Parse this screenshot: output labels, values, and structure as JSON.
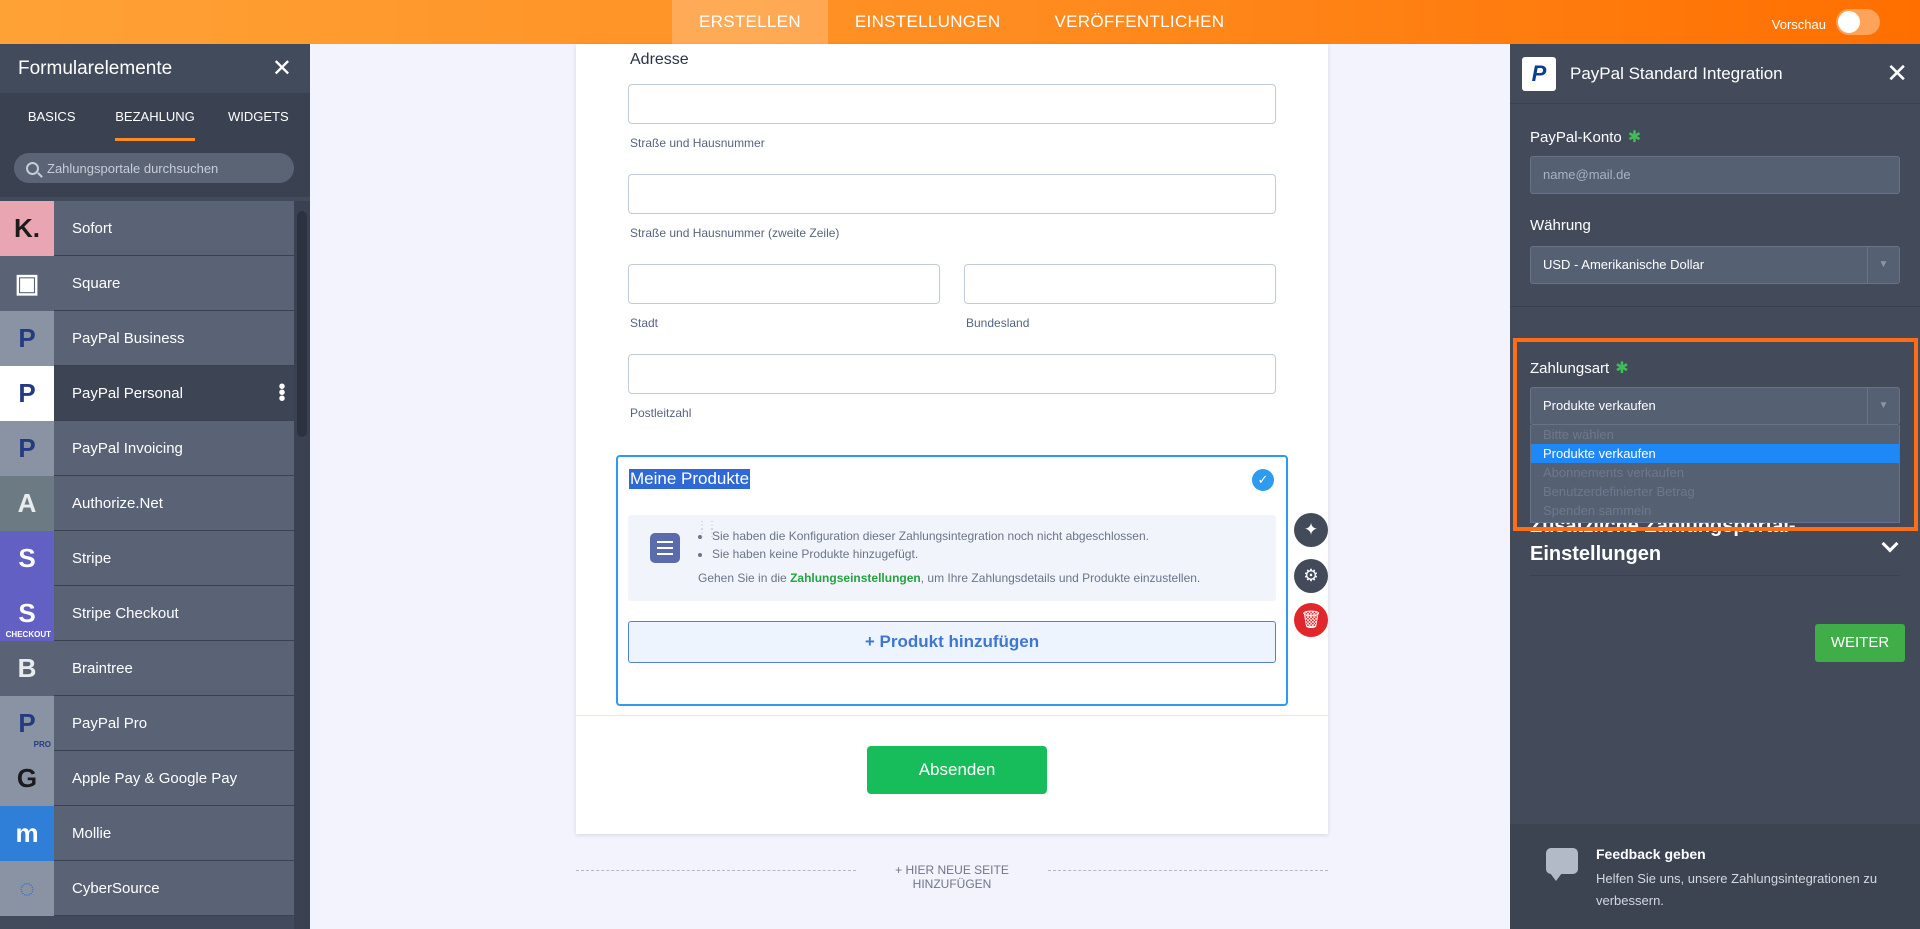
{
  "topbar": {
    "tabs": [
      "ERSTELLEN",
      "EINSTELLUNGEN",
      "VERÖFFENTLICHEN"
    ],
    "active_tab": "ERSTELLEN",
    "preview_label": "Vorschau"
  },
  "left_panel": {
    "title": "Formularelemente",
    "tabs": [
      "BASICS",
      "BEZAHLUNG",
      "WIDGETS"
    ],
    "active_tab": "BEZAHLUNG",
    "search_placeholder": "Zahlungsportale durchsuchen",
    "items": [
      {
        "label": "Sofort",
        "icon": "sofort-icon",
        "glyph": "K.",
        "bg": "#eaa5b2",
        "fg": "#1b1b1b"
      },
      {
        "label": "Square",
        "icon": "square-icon",
        "glyph": "▣",
        "bg": "#5a6375",
        "fg": "#ffffff"
      },
      {
        "label": "PayPal Business",
        "icon": "paypal-business-icon",
        "glyph": "P",
        "bg": "#8a93a4",
        "fg": "#253b80"
      },
      {
        "label": "PayPal Personal",
        "icon": "paypal-personal-icon",
        "glyph": "P",
        "bg": "#ffffff",
        "fg": "#253b80"
      },
      {
        "label": "PayPal Invoicing",
        "icon": "paypal-invoicing-icon",
        "glyph": "P",
        "bg": "#8a93a4",
        "fg": "#253b80"
      },
      {
        "label": "Authorize.Net",
        "icon": "authorize-net-icon",
        "glyph": "A",
        "bg": "#6b7a83",
        "fg": "#e8ecef"
      },
      {
        "label": "Stripe",
        "icon": "stripe-icon",
        "glyph": "S",
        "bg": "#6360c4",
        "fg": "#ffffff"
      },
      {
        "label": "Stripe Checkout",
        "icon": "stripe-checkout-icon",
        "glyph": "S",
        "bg": "#6360c4",
        "fg": "#ffffff",
        "caption": "CHECKOUT"
      },
      {
        "label": "Braintree",
        "icon": "braintree-icon",
        "glyph": "B",
        "bg": "#5a6375",
        "fg": "#e8ecef"
      },
      {
        "label": "PayPal Pro",
        "icon": "paypal-pro-icon",
        "glyph": "P",
        "bg": "#8a93a4",
        "fg": "#253b80",
        "caption": "PRO"
      },
      {
        "label": "Apple Pay & Google Pay",
        "icon": "apple-google-pay-icon",
        "glyph": "G",
        "bg": "#8a93a4",
        "fg": "#1b1b1b"
      },
      {
        "label": "Mollie",
        "icon": "mollie-icon",
        "glyph": "m",
        "bg": "#2f7fd8",
        "fg": "#ffffff"
      },
      {
        "label": "CyberSource",
        "icon": "cybersource-icon",
        "glyph": "◌",
        "bg": "#8a93a4",
        "fg": "#2d6fd1"
      }
    ],
    "selected_item": "PayPal Personal"
  },
  "form": {
    "address_label": "Adresse",
    "street_label": "Straße und Hausnummer",
    "street2_label": "Straße und Hausnummer (zweite Zeile)",
    "city_label": "Stadt",
    "state_label": "Bundesland",
    "zip_label": "Postleitzahl",
    "products_title": "Meine Produkte",
    "notice_items": [
      "Sie haben die Konfiguration dieser Zahlungsintegration noch nicht abgeschlossen.",
      "Sie haben keine Produkte hinzugefügt."
    ],
    "notice_hint_prefix": "Gehen Sie in die ",
    "notice_hint_link": "Zahlungseinstellungen",
    "notice_hint_suffix": ", um Ihre Zahlungsdetails und Produkte einzustellen.",
    "add_product_label": "+ Produkt hinzufügen",
    "submit_label": "Absenden",
    "new_page_label": "+ HIER NEUE SEITE HINZUFÜGEN"
  },
  "right_panel": {
    "title": "PayPal Standard Integration",
    "account_label": "PayPal-Konto",
    "account_placeholder": "name@mail.de",
    "currency_label": "Währung",
    "currency_value": "USD - Amerikanische Dollar",
    "payment_type_label": "Zahlungsart",
    "payment_type_value": "Produkte verkaufen",
    "payment_type_options": [
      "Bitte wählen",
      "Produkte verkaufen",
      "Abonnements verkaufen",
      "Benutzerdefinierter Betrag",
      "Spenden sammeln"
    ],
    "extra_settings_label": "Zusätzliche Zahlungsportal-Einstellungen",
    "extra_settings_line1": "Zusätzliche Zahlungsportal-",
    "extra_settings_line2": "Einstellungen",
    "next_label": "WEITER",
    "feedback_title": "Feedback geben",
    "feedback_text": "Helfen Sie uns, unsere Zahlungsintegrationen zu verbessern."
  },
  "colors": {
    "accent_orange": "#ff8b1f",
    "selection_blue": "#2e9bf0",
    "submit_green": "#18bd5b",
    "highlight_orange": "#ff6e14"
  }
}
